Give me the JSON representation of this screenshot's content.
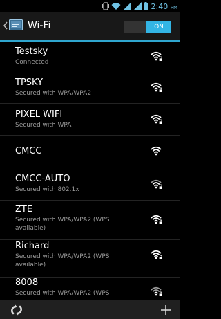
{
  "status_bar": {
    "time": "2:40",
    "ampm": "PM",
    "icons": [
      "vibrate-icon",
      "wifi-status-icon",
      "signal-icon-1",
      "signal-icon-2",
      "battery-icon"
    ]
  },
  "header": {
    "title": "Wi-Fi",
    "toggle_label": "ON",
    "icons": [
      "back-caret-icon",
      "wifi-settings-app-icon"
    ]
  },
  "networks": [
    {
      "name": "Testsky",
      "status": "Connected",
      "secured": true
    },
    {
      "name": "TPSKY",
      "status": "Secured with WPA/WPA2",
      "secured": true
    },
    {
      "name": "PIXEL WIFI",
      "status": "Secured with WPA",
      "secured": true
    },
    {
      "name": "CMCC",
      "status": "",
      "secured": false
    },
    {
      "name": "CMCC-AUTO",
      "status": "Secured with 802.1x",
      "secured": true
    },
    {
      "name": "ZTE",
      "status": "Secured with WPA/WPA2 (WPS available)",
      "secured": true
    },
    {
      "name": "Richard",
      "status": "Secured with WPA/WPA2 (WPS available)",
      "secured": true
    },
    {
      "name": "8008",
      "status": "Secured with WPA/WPA2 (WPS",
      "secured": true
    }
  ],
  "bottom_bar": {
    "icons": [
      "wps-icon",
      "add-network-icon"
    ]
  },
  "colors": {
    "accent": "#33b5e5",
    "background": "#000000",
    "secondary_text": "#9a9a9a"
  }
}
